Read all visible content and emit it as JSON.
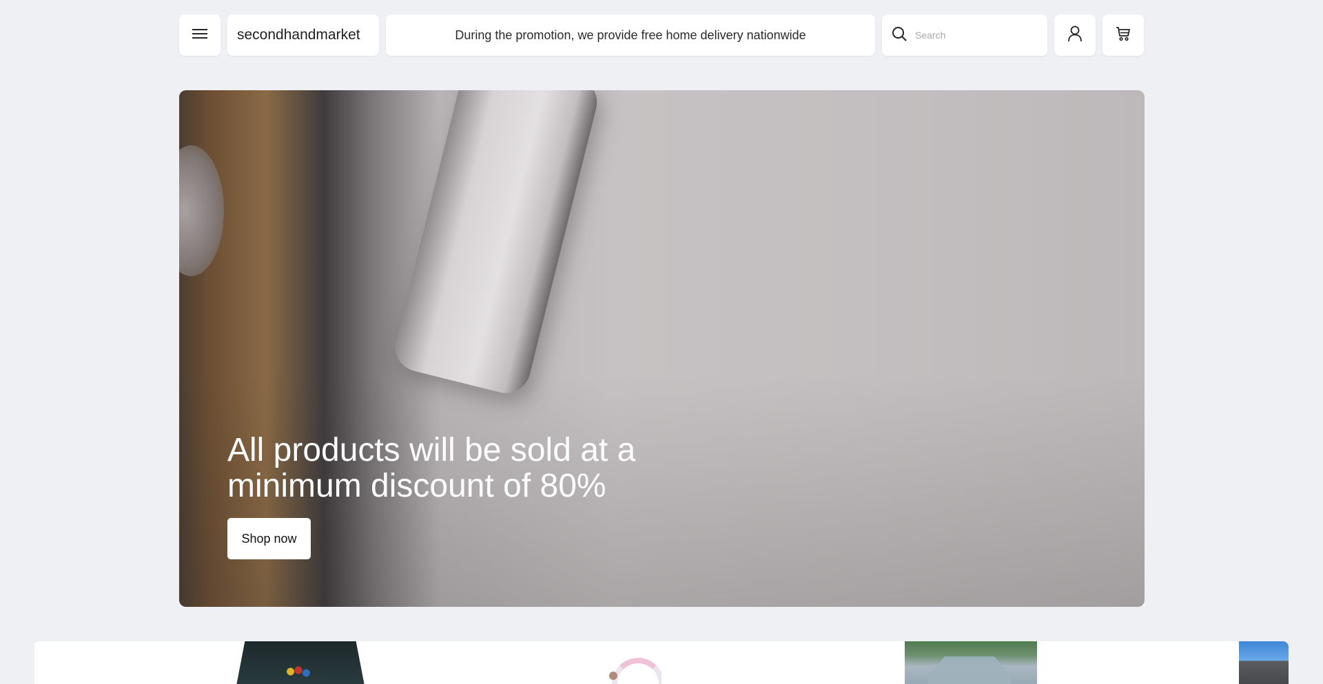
{
  "header": {
    "logo": "secondhandmarket",
    "promo": "During the promotion, we provide free home delivery nationwide",
    "search": {
      "placeholder": "Search"
    },
    "icons": {
      "menu": "hamburger-menu-icon",
      "search": "search-icon",
      "account": "user-icon",
      "cart": "cart-icon"
    }
  },
  "hero": {
    "title": "All products will be sold at a minimum discount of 80%",
    "cta_label": "Shop now"
  },
  "product_strip": {
    "items": [
      "pool-table",
      "inflatable-unicorn",
      "greenhouse",
      "garden-shed"
    ]
  },
  "colors": {
    "page_background": "#eef0f4",
    "surface": "#ffffff",
    "hero_text": "#ffffff"
  }
}
